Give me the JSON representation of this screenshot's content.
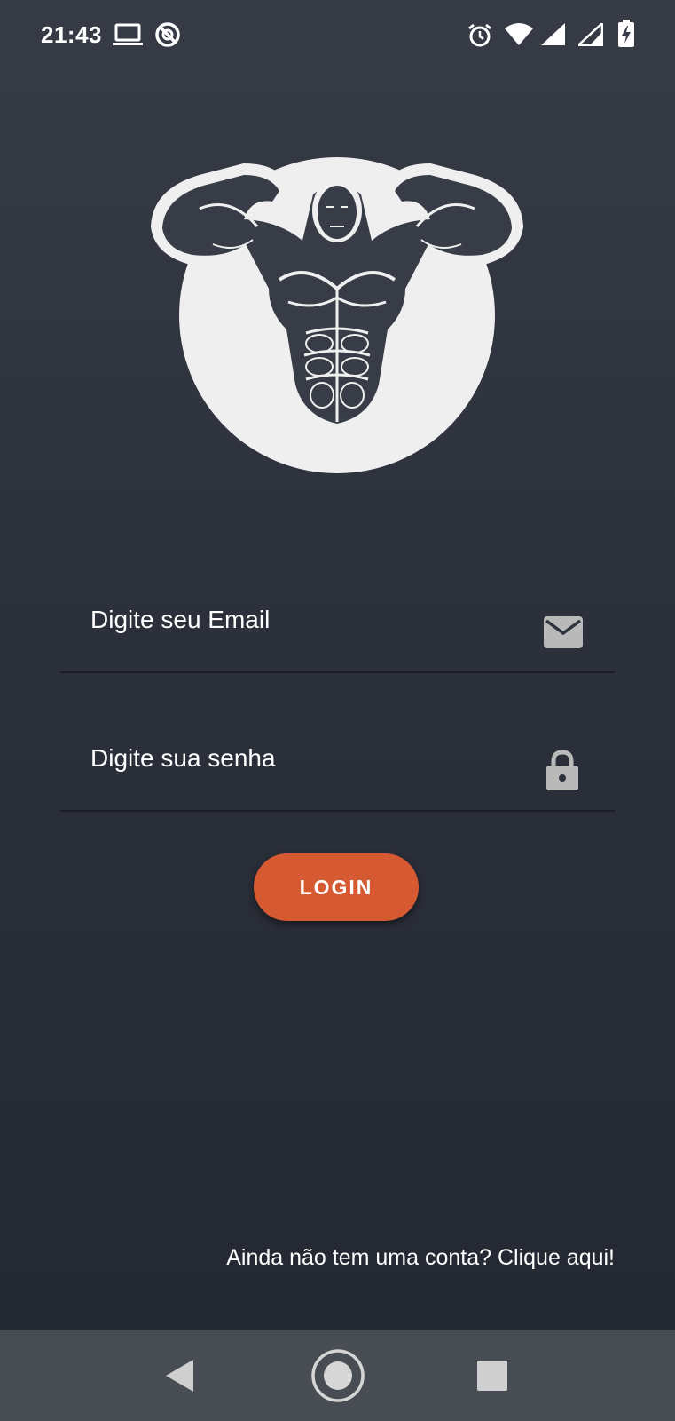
{
  "status_bar": {
    "time": "21:43",
    "left_icons": [
      "laptop-icon",
      "do-not-disturb-icon"
    ],
    "right_icons": [
      "alarm-icon",
      "wifi-icon",
      "signal-icon",
      "signal-icon-2",
      "battery-charging-icon"
    ]
  },
  "logo": {
    "icon": "bodybuilder-logo",
    "circle_color": "#efefef"
  },
  "form": {
    "email": {
      "placeholder": "Digite seu Email",
      "icon": "mail-icon"
    },
    "password": {
      "placeholder": "Digite sua senha",
      "icon": "lock-icon"
    },
    "login_label": "LOGIN",
    "accent": "#d55a32"
  },
  "signup_link": "Ainda não tem uma conta? Clique aqui!",
  "nav_bar": {
    "back": "back-icon",
    "home": "home-icon",
    "recents": "recents-icon"
  }
}
